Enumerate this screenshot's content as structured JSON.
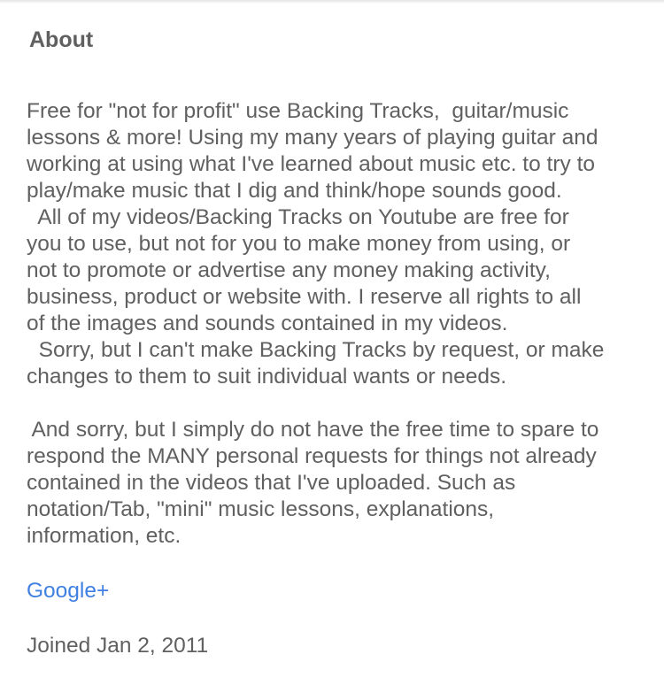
{
  "about": {
    "title": "About",
    "description_lines": [
      "Free for \"not for profit\" use Backing Tracks,  guitar/music",
      "lessons & more! Using my many years of playing guitar and",
      "working at using what I've learned about music etc. to try to",
      "play/make music that I dig and think/hope sounds good.",
      "  All of my videos/Backing Tracks on Youtube are free for",
      "you to use, but not for you to make money from using, or",
      "not to promote or advertise any money making activity,",
      "business, product or website with. I reserve all rights to all",
      "of the images and sounds contained in my videos.",
      "  Sorry, but I can't make Backing Tracks by request, or make",
      "changes to them to suit individual wants or needs.",
      "",
      " And sorry, but I simply do not have the free time to spare to",
      "respond the MANY personal requests for things not already",
      "contained in the videos that I've uploaded. Such as",
      "notation/Tab, \"mini\" music lessons, explanations,",
      "information, etc."
    ],
    "link_label": "Google+",
    "joined": "Joined Jan 2, 2011"
  },
  "colors": {
    "text": "#606060",
    "link": "#3f80e0",
    "background": "#ffffff"
  }
}
